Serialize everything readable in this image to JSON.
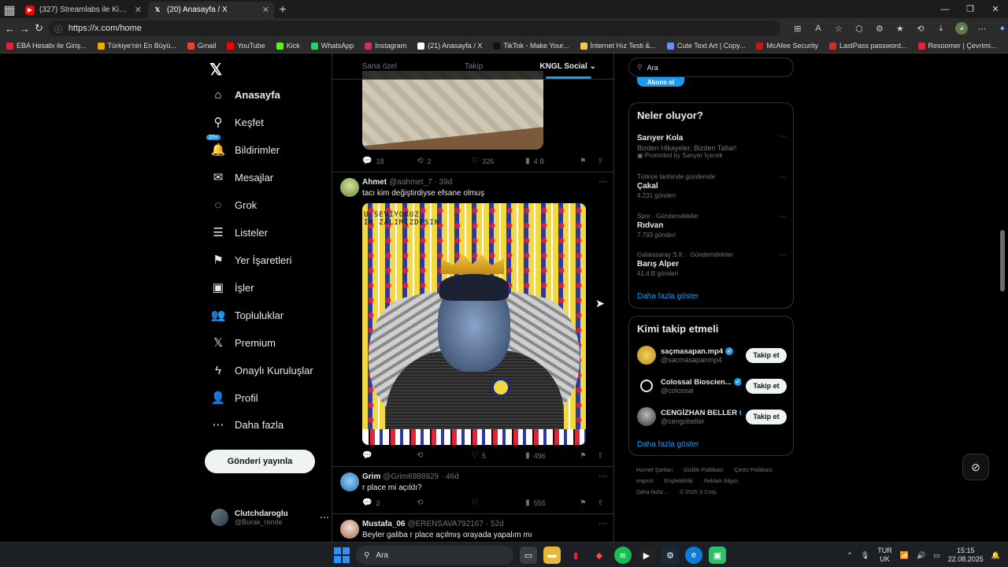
{
  "browser": {
    "tabs": [
      {
        "title": "(327) Streamlabs ile Kick'te Nasıl",
        "active": false,
        "favicon": "youtube-icon"
      },
      {
        "title": "(20) Anasayfa / X",
        "active": true,
        "favicon": "x-logo-icon"
      }
    ],
    "url": "https://x.com/home",
    "bookmarks": [
      {
        "label": "EBA Hesabı ile Giriş...",
        "color": "#e0243a"
      },
      {
        "label": "Türkiye'nin En Büyü...",
        "color": "#f2a900"
      },
      {
        "label": "Gmail",
        "color": "#ea4335"
      },
      {
        "label": "YouTube",
        "color": "#ff0000"
      },
      {
        "label": "Kick",
        "color": "#53fc18"
      },
      {
        "label": "WhatsApp",
        "color": "#25d366"
      },
      {
        "label": "Instagram",
        "color": "#d62976"
      },
      {
        "label": "(21) Anasayfa / X",
        "color": "#ffffff"
      },
      {
        "label": "TikTok - Make Your...",
        "color": "#111111"
      },
      {
        "label": "İnternet Hız Testi &...",
        "color": "#f2c94c"
      },
      {
        "label": "Cute Text Art | Copy...",
        "color": "#6b8cff"
      },
      {
        "label": "McAfee Security",
        "color": "#c01818"
      },
      {
        "label": "LastPass password...",
        "color": "#d32d27"
      },
      {
        "label": "Resoomer | Çevrimi...",
        "color": "#e0243a"
      }
    ]
  },
  "sidebar": {
    "items": [
      {
        "label": "Anasayfa",
        "icon": "home-icon",
        "glyph": "⌂",
        "active": true
      },
      {
        "label": "Keşfet",
        "icon": "search-icon",
        "glyph": "⚲"
      },
      {
        "label": "Bildirimler",
        "icon": "bell-icon",
        "glyph": "🔔",
        "badge": "20+"
      },
      {
        "label": "Mesajlar",
        "icon": "mail-icon",
        "glyph": "✉"
      },
      {
        "label": "Grok",
        "icon": "grok-icon",
        "glyph": "◌"
      },
      {
        "label": "Listeler",
        "icon": "list-icon",
        "glyph": "☰"
      },
      {
        "label": "Yer İşaretleri",
        "icon": "bookmark-icon",
        "glyph": "⚑"
      },
      {
        "label": "İşler",
        "icon": "briefcase-icon",
        "glyph": "▣"
      },
      {
        "label": "Topluluklar",
        "icon": "communities-icon",
        "glyph": "👥"
      },
      {
        "label": "Premium",
        "icon": "x-premium-icon",
        "glyph": "𝕏"
      },
      {
        "label": "Onaylı Kuruluşlar",
        "icon": "lightning-icon",
        "glyph": "ϟ"
      },
      {
        "label": "Profil",
        "icon": "person-icon",
        "glyph": "👤"
      },
      {
        "label": "Daha fazla",
        "icon": "more-circle-icon",
        "glyph": "⋯"
      }
    ],
    "post_button": "Gönderi yayınla",
    "account": {
      "name": "Clutchdaroglu",
      "handle": "@Burak_rende"
    }
  },
  "timeline": {
    "tabs": [
      "Sana özel",
      "Takip",
      "KNGL Social"
    ],
    "top_post_actions": {
      "replies": "18",
      "reposts": "2",
      "likes": "326",
      "views": "4 B"
    },
    "posts": [
      {
        "name": "Ahmet",
        "meta": "@aahmet_7 · 39d",
        "text": "tacı kim değiştirdiyse efsane olmuş",
        "actions": {
          "replies": "",
          "reposts": "",
          "likes": "5",
          "views": "496"
        },
        "art_text": "U SEVIYORUZ\nIN ZALIMIZDESIN"
      },
      {
        "name": "Grim",
        "meta": "@Grim6988929 · 46d",
        "text": "r place mi açıldı?",
        "actions": {
          "replies": "2",
          "reposts": "",
          "likes": "",
          "views": "555"
        }
      },
      {
        "name": "Mustafa_06",
        "meta": "@ERENSAVA792167 · 52d",
        "text": "Beyler galiba r place açılmış orayada yapalım mı"
      }
    ]
  },
  "right": {
    "search_placeholder": "Ara",
    "subscribe_label": "Abone ol",
    "trends_title": "Neler oluyor?",
    "trends": [
      {
        "context": "",
        "title": "Sarıyer Kola",
        "subtitle": "Bizden Hikayeler, Bizden Tatlar!",
        "count": "Promoted by Sarıyer İçecek"
      },
      {
        "context": "Türkiye tarihinde gündemde",
        "title": "Çakal",
        "count": "4.231 gönderi"
      },
      {
        "context": "Spor · Gündemdekiler",
        "title": "Rıdvan",
        "count": "7.793 gönderi"
      },
      {
        "context": "Galatasaray S.K. · Gündemdekiler",
        "title": "Barış Alper",
        "count": "41,4 B gönderi"
      }
    ],
    "show_more": "Daha fazla göster",
    "who_title": "Kimi takip etmeli",
    "who": [
      {
        "name": "saçmasapan.mp4",
        "handle": "@sacmasapanmp4",
        "color": "#d8b23a"
      },
      {
        "name": "Colossal Bioscien...",
        "handle": "@colossal",
        "color": "#000000"
      },
      {
        "name": "CENGİZHAN BELLER",
        "handle": "@cengobeller",
        "color": "#4a4a4a"
      }
    ],
    "follow_label": "Takip et",
    "show_more_2": "Daha fazla göster",
    "footer": [
      "Hizmet Şartları",
      "Gizlilik Politikası",
      "Çerez Politikası",
      "Imprint",
      "Erişilebilirlik",
      "Reklam bilgisi",
      "Daha fazla ...",
      "© 2025 X Corp."
    ]
  },
  "taskbar": {
    "search": "Ara",
    "lang_top": "TUR",
    "lang_bottom": "UK",
    "time": "15:15",
    "date": "22.08.2025"
  }
}
